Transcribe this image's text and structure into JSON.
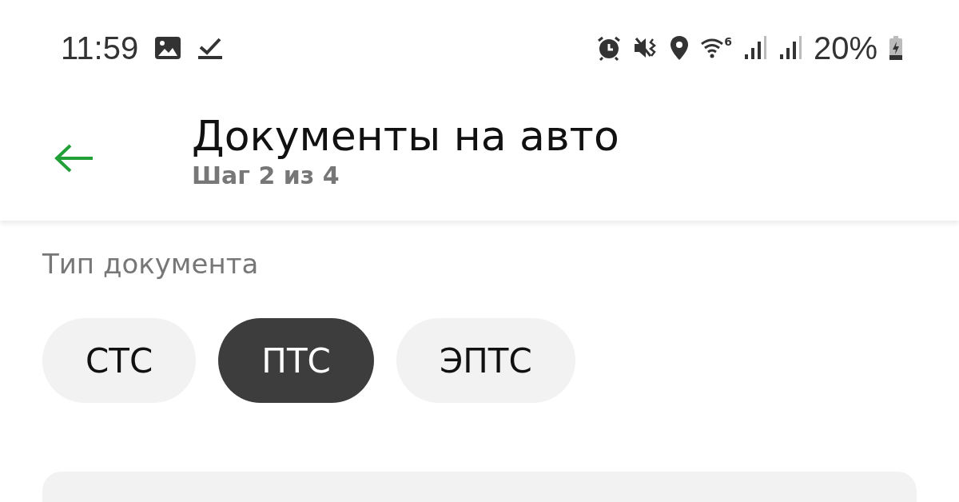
{
  "status_bar": {
    "time": "11:59",
    "wifi_standard": "6",
    "battery": "20%"
  },
  "header": {
    "title": "Документы на авто",
    "subtitle": "Шаг 2 из 4"
  },
  "document_type": {
    "label": "Тип документа",
    "options": [
      {
        "label": "СТС",
        "selected": false
      },
      {
        "label": "ПТС",
        "selected": true
      },
      {
        "label": "ЭПТС",
        "selected": false
      }
    ]
  }
}
